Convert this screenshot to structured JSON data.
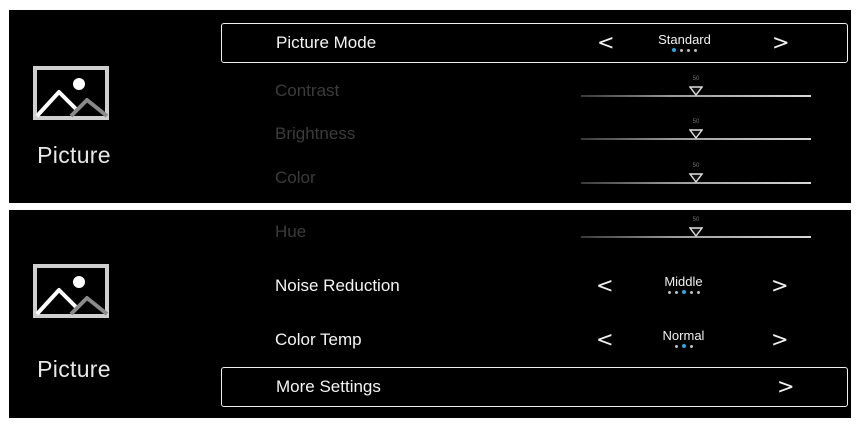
{
  "colors": {
    "background": "#000000",
    "text": "#f4f4f4",
    "disabled_text": "#3c3c3c",
    "active_dot": "#2aa6e0",
    "selection_border": "#f0f0f0"
  },
  "screens": [
    {
      "section": {
        "label": "Picture",
        "icon": "picture-icon"
      },
      "rows": [
        {
          "label": "Picture Mode",
          "type": "selector",
          "value": "Standard",
          "option_count": 4,
          "active_index": 0,
          "selected": true,
          "enabled": true
        },
        {
          "label": "Contrast",
          "type": "slider",
          "value": "50",
          "level": 50,
          "enabled": false
        },
        {
          "label": "Brightness",
          "type": "slider",
          "value": "50",
          "level": 50,
          "enabled": false
        },
        {
          "label": "Color",
          "type": "slider",
          "value": "50",
          "level": 50,
          "enabled": false
        }
      ]
    },
    {
      "section": {
        "label": "Picture",
        "icon": "picture-icon"
      },
      "rows": [
        {
          "label": "Hue",
          "type": "slider",
          "value": "50",
          "level": 50,
          "enabled": false
        },
        {
          "label": "Noise Reduction",
          "type": "selector",
          "value": "Middle",
          "option_count": 5,
          "active_index": 2,
          "enabled": true
        },
        {
          "label": "Color Temp",
          "type": "selector",
          "value": "Normal",
          "option_count": 3,
          "active_index": 1,
          "enabled": true
        },
        {
          "label": "More Settings",
          "type": "link",
          "selected": true,
          "enabled": true
        }
      ]
    }
  ],
  "arrows": {
    "left": "<",
    "right": ">"
  }
}
